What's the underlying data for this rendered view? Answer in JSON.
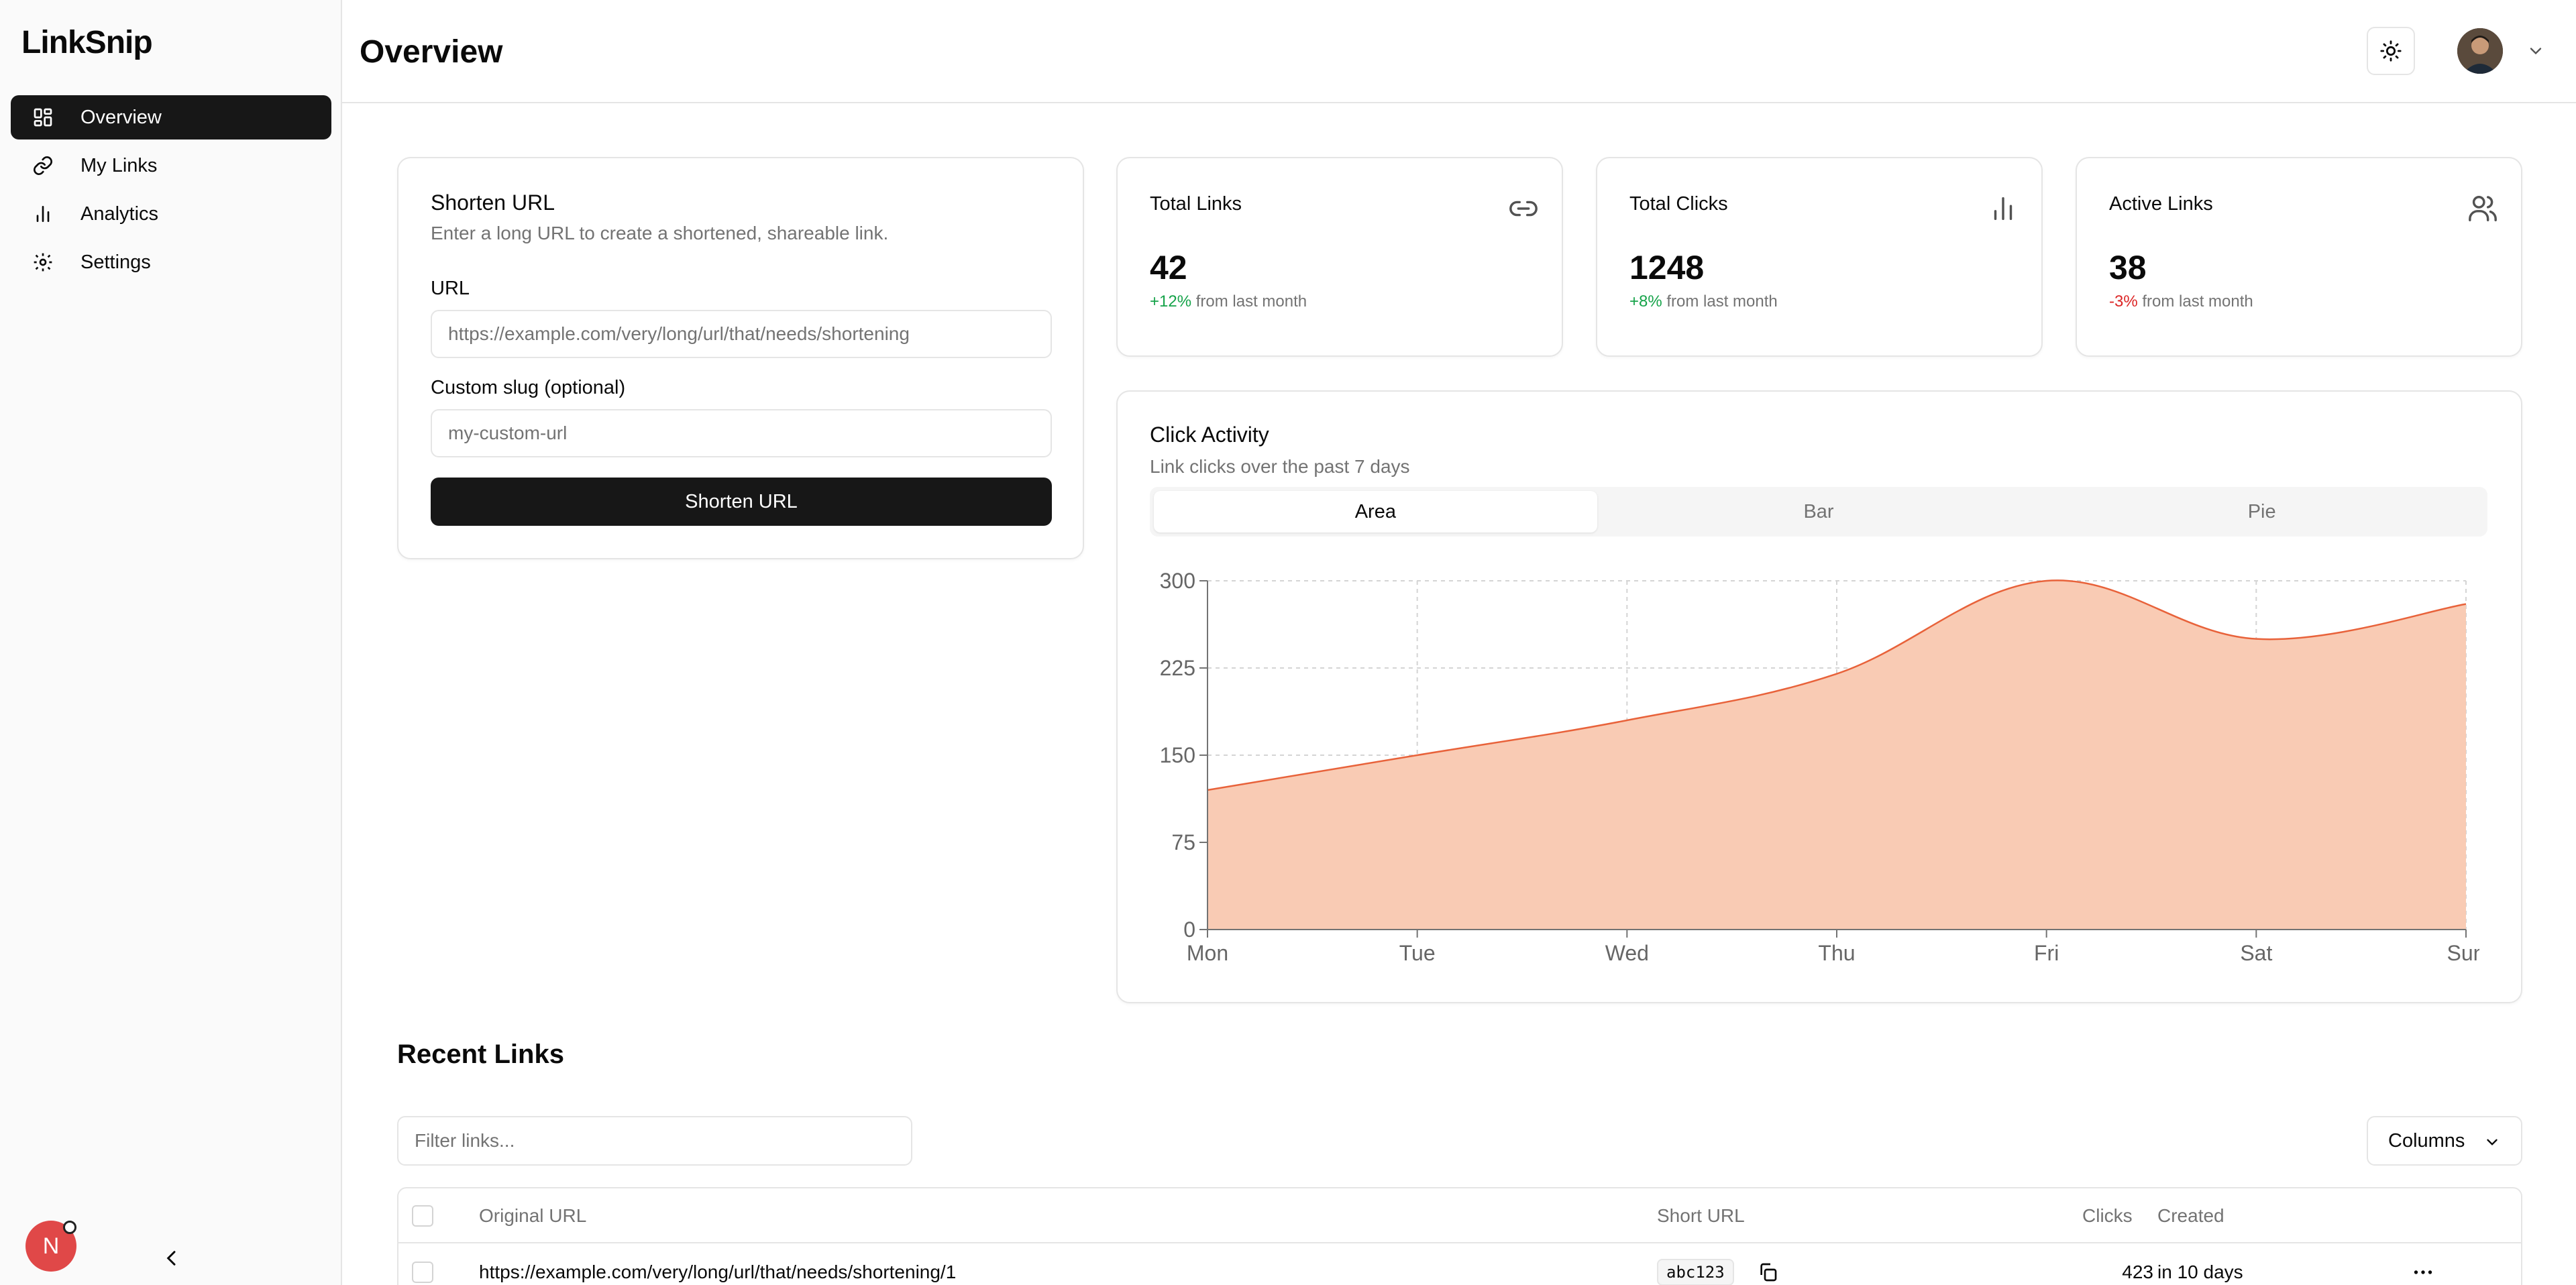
{
  "app": {
    "name": "LinkSnip"
  },
  "sidebar": {
    "items": [
      {
        "label": "Overview",
        "icon": "dashboard-icon",
        "active": true
      },
      {
        "label": "My Links",
        "icon": "link-icon",
        "active": false
      },
      {
        "label": "Analytics",
        "icon": "bar-chart-icon",
        "active": false
      },
      {
        "label": "Settings",
        "icon": "gear-icon",
        "active": false
      }
    ],
    "user_initial": "N"
  },
  "header": {
    "title": "Overview"
  },
  "shorten": {
    "title": "Shorten URL",
    "description": "Enter a long URL to create a shortened, shareable link.",
    "url_label": "URL",
    "url_placeholder": "https://example.com/very/long/url/that/needs/shortening",
    "slug_label": "Custom slug (optional)",
    "slug_placeholder": "my-custom-url",
    "submit_label": "Shorten URL"
  },
  "stats": [
    {
      "title": "Total Links",
      "value": "42",
      "change": "+12%",
      "change_suffix": "from last month",
      "trend": "up",
      "icon": "link-icon"
    },
    {
      "title": "Total Clicks",
      "value": "1248",
      "change": "+8%",
      "change_suffix": "from last month",
      "trend": "up",
      "icon": "bar-chart-icon"
    },
    {
      "title": "Active Links",
      "value": "38",
      "change": "-3%",
      "change_suffix": "from last month",
      "trend": "down",
      "icon": "users-icon"
    }
  ],
  "activity": {
    "title": "Click Activity",
    "subtitle": "Link clicks over the past 7 days",
    "tabs": [
      "Area",
      "Bar",
      "Pie"
    ],
    "active_tab": "Area"
  },
  "chart_data": {
    "type": "area",
    "categories": [
      "Mon",
      "Tue",
      "Wed",
      "Thu",
      "Fri",
      "Sat",
      "Sun"
    ],
    "values": [
      120,
      150,
      180,
      220,
      300,
      250,
      280
    ],
    "yticks": [
      0,
      75,
      150,
      225,
      300
    ],
    "ylim": [
      0,
      300
    ],
    "grid": true,
    "colors": {
      "fill": "#f9cbb4",
      "stroke": "#e8623a"
    }
  },
  "recent": {
    "title": "Recent Links",
    "filter_placeholder": "Filter links...",
    "columns_label": "Columns",
    "headers": {
      "original": "Original URL",
      "short": "Short URL",
      "clicks": "Clicks",
      "created": "Created"
    },
    "rows": [
      {
        "original": "https://example.com/very/long/url/that/needs/shortening/1",
        "short": "abc123",
        "clicks": "423",
        "created": "in 10 days"
      }
    ]
  }
}
